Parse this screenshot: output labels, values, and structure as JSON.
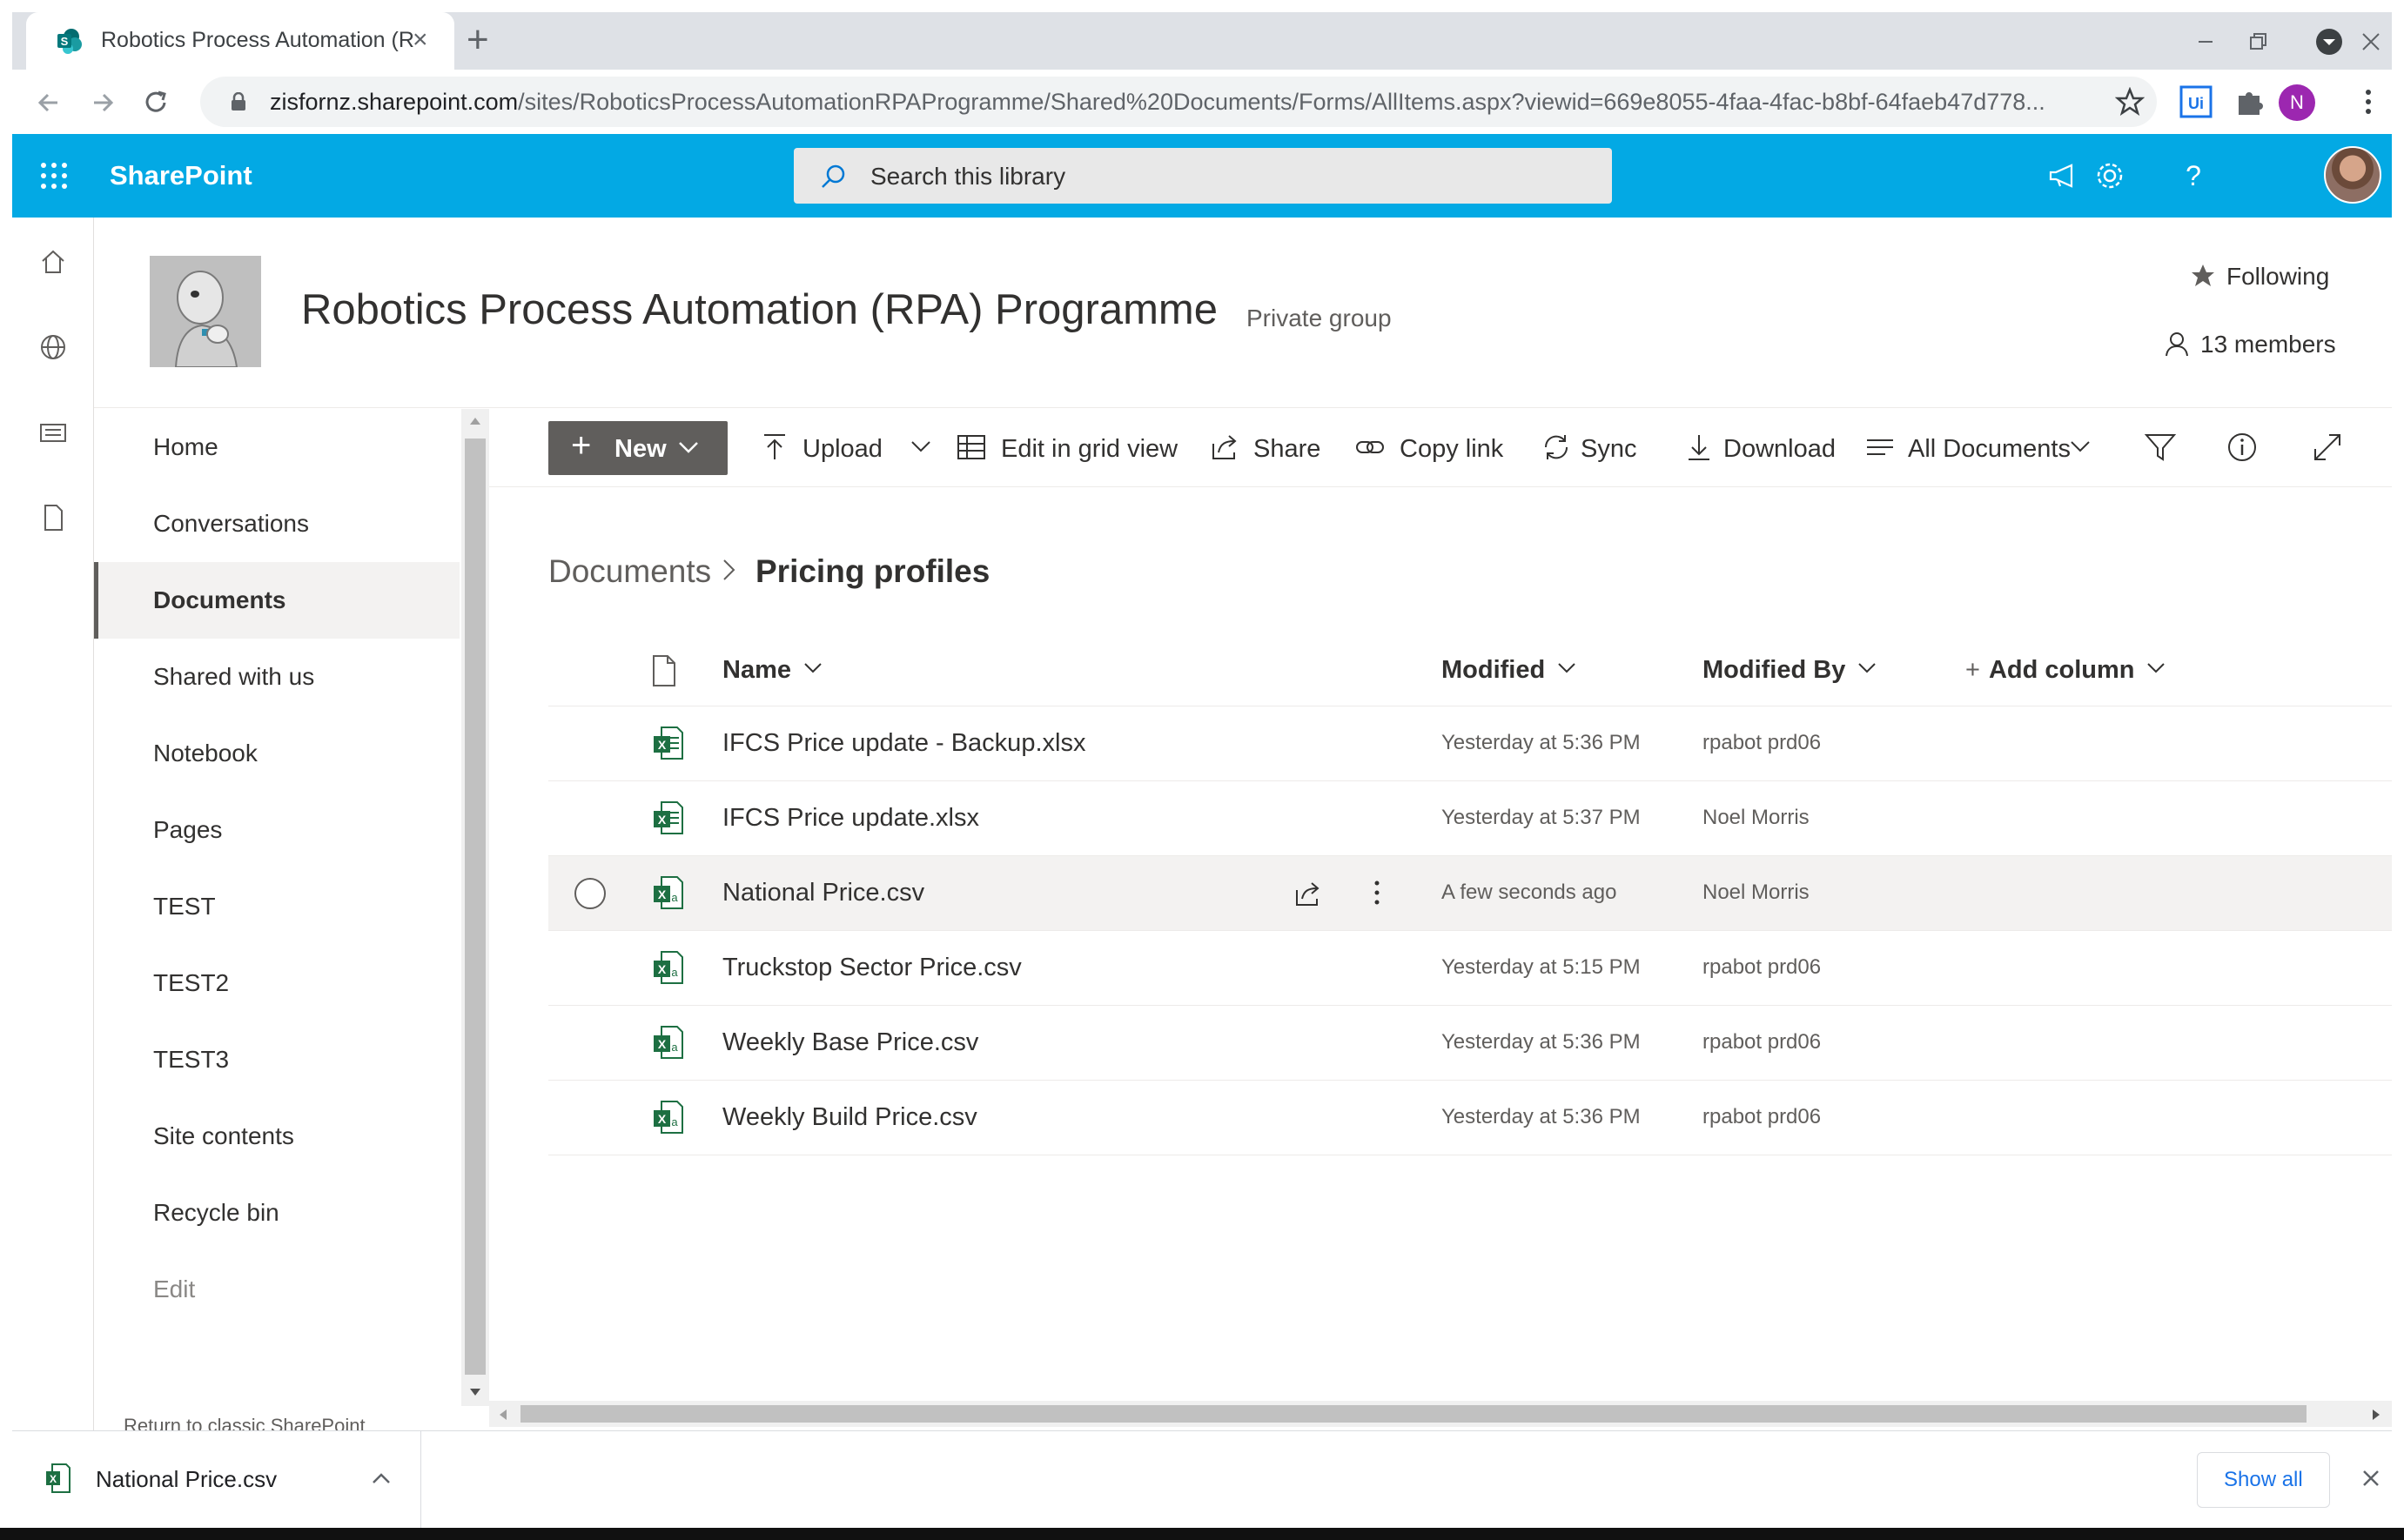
{
  "browser": {
    "tab_title": "Robotics Process Automation (RPA) Programme - Pricing profiles - All Documents",
    "url_host": "zisfornz.sharepoint.com",
    "url_path": "/sites/RoboticsProcessAutomationRPAProgramme/Shared%20Documents/Forms/AllItems.aspx?viewid=669e8055-4faa-4fac-b8bf-64faeb47d778...",
    "profile_initial": "N"
  },
  "suitebar": {
    "brand": "SharePoint",
    "search_placeholder": "Search this library",
    "color": "#03a9e4"
  },
  "site": {
    "title": "Robotics Process Automation (RPA) Programme",
    "privacy": "Private group",
    "following_label": "Following",
    "members_label": "13 members"
  },
  "leftnav": {
    "items": [
      {
        "label": "Home"
      },
      {
        "label": "Conversations"
      },
      {
        "label": "Documents",
        "selected": true
      },
      {
        "label": "Shared with us"
      },
      {
        "label": "Notebook"
      },
      {
        "label": "Pages"
      },
      {
        "label": "TEST"
      },
      {
        "label": "TEST2"
      },
      {
        "label": "TEST3"
      },
      {
        "label": "Site contents"
      },
      {
        "label": "Recycle bin"
      },
      {
        "label": "Edit"
      }
    ],
    "classic_link": "Return to classic SharePoint"
  },
  "commandbar": {
    "new": "New",
    "upload": "Upload",
    "edit_grid": "Edit in grid view",
    "share": "Share",
    "copy_link": "Copy link",
    "sync": "Sync",
    "download": "Download",
    "view": "All Documents"
  },
  "breadcrumb": {
    "root": "Documents",
    "current": "Pricing profiles"
  },
  "list": {
    "columns": {
      "name": "Name",
      "modified": "Modified",
      "modified_by": "Modified By",
      "add_column": "Add column"
    },
    "rows": [
      {
        "name": "IFCS Price update - Backup.xlsx",
        "modified": "Yesterday at 5:36 PM",
        "modified_by": "rpabot prd06",
        "type": "xlsx"
      },
      {
        "name": "IFCS Price update.xlsx",
        "modified": "Yesterday at 5:37 PM",
        "modified_by": "Noel Morris",
        "type": "xlsx"
      },
      {
        "name": "National Price.csv",
        "modified": "A few seconds ago",
        "modified_by": "Noel Morris",
        "type": "csv",
        "hover": true
      },
      {
        "name": "Truckstop Sector Price.csv",
        "modified": "Yesterday at 5:15 PM",
        "modified_by": "rpabot prd06",
        "type": "csv"
      },
      {
        "name": "Weekly Base Price.csv",
        "modified": "Yesterday at 5:36 PM",
        "modified_by": "rpabot prd06",
        "type": "csv"
      },
      {
        "name": "Weekly Build Price.csv",
        "modified": "Yesterday at 5:36 PM",
        "modified_by": "rpabot prd06",
        "type": "csv"
      }
    ]
  },
  "downloads": {
    "file_name": "National Price.csv",
    "show_all": "Show all"
  },
  "colors": {
    "excel_green": "#1d6f42",
    "command_new_bg": "#605e5c",
    "chrome_frame": "#dee1e6"
  }
}
